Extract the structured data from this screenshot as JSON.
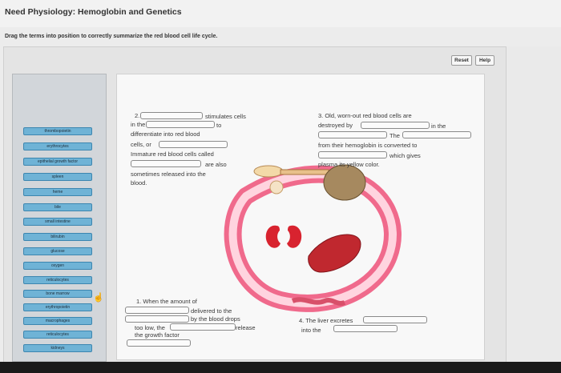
{
  "page": {
    "title": "Need Physiology: Hemoglobin and Genetics",
    "instruction": "Drag the terms into position to correctly summarize the red blood cell life cycle."
  },
  "controls": {
    "reset": "Reset",
    "help": "Help"
  },
  "terms": [
    "thrombopoietin",
    "erythrocytes",
    "epithelial growth factor",
    "spleen",
    "heme",
    "bile",
    "small intestine",
    "bilirubin",
    "glucose",
    "oxygen",
    "reticulocytes",
    "bone marrow",
    "erythropoietin",
    "macrophages",
    "reticulocytes",
    "kidneys"
  ],
  "step2": {
    "num": "2.",
    "stimulates": "stimulates cells",
    "in_the": "in the",
    "to": "to",
    "differentiate": "differentiate into red blood",
    "cells_or": "cells, or",
    "immature": "Immature red blood cells called",
    "are_also": "are also",
    "released": "sometimes released into the",
    "blood": "blood."
  },
  "step3": {
    "intro": "3. Old, worn-out red blood cells are",
    "destroyed": "destroyed by",
    "in_the": "in the",
    "the": "The",
    "from": "from their hemoglobin is converted to",
    "which": "which gives",
    "plasma": "plasma its yellow color."
  },
  "step1": {
    "when": "1. When the amount of",
    "delivered": "delivered to the",
    "by": "by the blood drops",
    "too_low": "too low, the",
    "release": "release",
    "factor": "the growth factor"
  },
  "step4": {
    "liver": "4. The liver excretes",
    "into": "into the"
  },
  "colors": {
    "term_fill": "#6fb3d6",
    "vessel": "#f06a8c",
    "organ": "#c8202f"
  }
}
